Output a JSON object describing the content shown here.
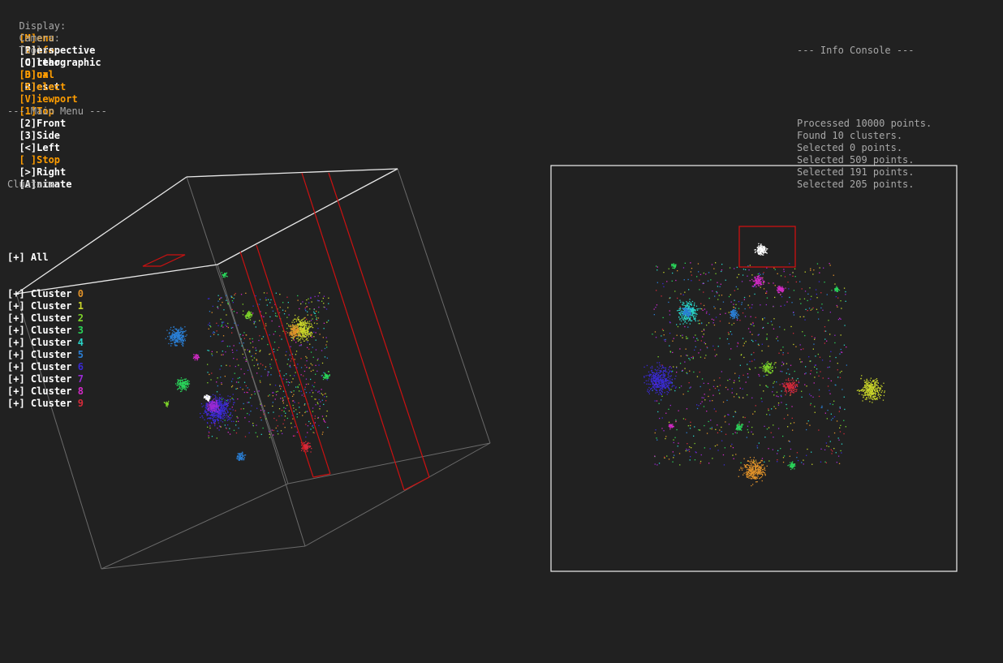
{
  "toolbar": {
    "display": {
      "label": "Display:",
      "items": [
        "[M]enu",
        "[I]nfo"
      ]
    },
    "camera": {
      "label": "Camera:",
      "items": [
        "[P]erspective",
        "[O]rthographic",
        "[D]ual",
        "[R]eset"
      ]
    },
    "tools": {
      "label": "Tools:",
      "items": [
        "[C]lear",
        "[B]ox",
        "[S]elect",
        "[V]iewport",
        "[1]Top",
        "[2]Front",
        "[3]Side",
        "[<]Left",
        "[ ]Stop",
        "[>]Right",
        "[A]nimate"
      ]
    }
  },
  "menu": {
    "title": "--- Main Menu ---",
    "clusters_label": "Clusters:",
    "all_label": "[+] All",
    "toggle": "[+]",
    "cluster_word": "Cluster",
    "clusters": [
      {
        "id": "0",
        "color": "#e0922a"
      },
      {
        "id": "1",
        "color": "#c8d42a"
      },
      {
        "id": "2",
        "color": "#7ed42a"
      },
      {
        "id": "3",
        "color": "#2ad45a"
      },
      {
        "id": "4",
        "color": "#2ad4c8"
      },
      {
        "id": "5",
        "color": "#2a7ed4"
      },
      {
        "id": "6",
        "color": "#3a2ad4"
      },
      {
        "id": "7",
        "color": "#9a2ad4"
      },
      {
        "id": "8",
        "color": "#d42ac8"
      },
      {
        "id": "9",
        "color": "#d42a3a"
      }
    ]
  },
  "console": {
    "title": "--- Info Console ---",
    "lines": [
      "Processed 10000 points.",
      "Found 10 clusters.",
      "Selected 0 points.",
      "Selected 509 points.",
      "Selected 191 points.",
      "Selected 205 points."
    ]
  },
  "colors": {
    "background": "#212121",
    "active": "#ff9d00",
    "inactive": "#ffffff",
    "text": "#a8a8a8",
    "selection": "#cc1111"
  }
}
